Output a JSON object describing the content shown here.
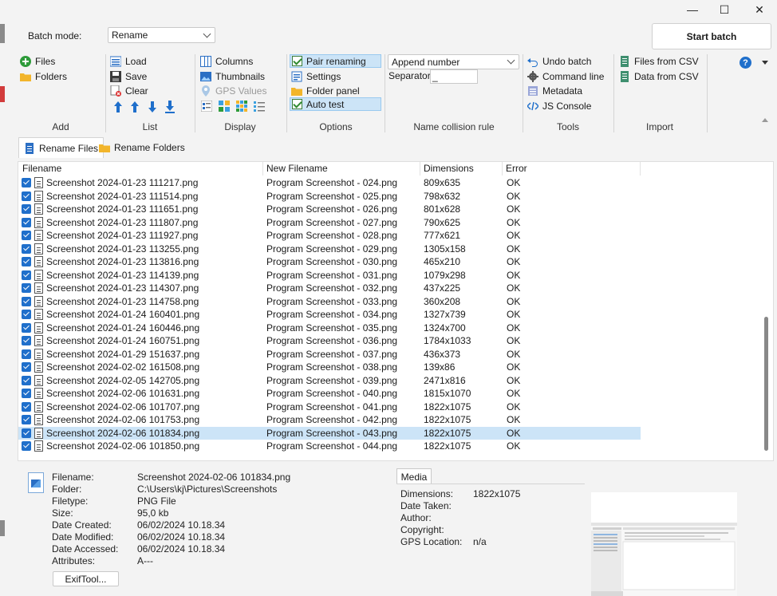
{
  "window": {
    "minimize_glyph": "—",
    "maximize_glyph": "☐",
    "close_glyph": "✕"
  },
  "topbar": {
    "batch_mode_label": "Batch mode:",
    "batch_mode_value": "Rename",
    "start_batch_label": "Start batch"
  },
  "ribbon": {
    "add": {
      "group_label": "Add",
      "files": "Files",
      "folders": "Folders"
    },
    "list": {
      "group_label": "List",
      "load": "Load",
      "save": "Save",
      "clear": "Clear"
    },
    "display": {
      "group_label": "Display",
      "columns": "Columns",
      "thumbnails": "Thumbnails",
      "gps_values": "GPS Values"
    },
    "options": {
      "group_label": "Options",
      "pair_renaming": "Pair renaming",
      "settings": "Settings",
      "folder_panel": "Folder panel",
      "auto_test": "Auto test"
    },
    "collision": {
      "group_label": "Name collision rule",
      "mode_value": "Append number",
      "separator_label": "Separator:",
      "separator_value": "_"
    },
    "tools": {
      "group_label": "Tools",
      "undo_batch": "Undo batch",
      "command_line": "Command line",
      "metadata": "Metadata",
      "js_console": "JS Console"
    },
    "import": {
      "group_label": "Import",
      "files_from_csv": "Files from CSV",
      "data_from_csv": "Data from CSV"
    },
    "help_glyph": "?"
  },
  "tabs": {
    "rename_files": "Rename Files",
    "rename_folders": "Rename Folders"
  },
  "table": {
    "headers": {
      "filename": "Filename",
      "new_filename": "New Filename",
      "dimensions": "Dimensions",
      "error": "Error"
    },
    "rows": [
      {
        "file": "Screenshot 2024-01-23 111217.png",
        "new": "Program Screenshot - 024.png",
        "dim": "809x635",
        "err": "OK"
      },
      {
        "file": "Screenshot 2024-01-23 111514.png",
        "new": "Program Screenshot - 025.png",
        "dim": "798x632",
        "err": "OK"
      },
      {
        "file": "Screenshot 2024-01-23 111651.png",
        "new": "Program Screenshot - 026.png",
        "dim": "801x628",
        "err": "OK"
      },
      {
        "file": "Screenshot 2024-01-23 111807.png",
        "new": "Program Screenshot - 027.png",
        "dim": "790x625",
        "err": "OK"
      },
      {
        "file": "Screenshot 2024-01-23 111927.png",
        "new": "Program Screenshot - 028.png",
        "dim": "777x621",
        "err": "OK"
      },
      {
        "file": "Screenshot 2024-01-23 113255.png",
        "new": "Program Screenshot - 029.png",
        "dim": "1305x158",
        "err": "OK"
      },
      {
        "file": "Screenshot 2024-01-23 113816.png",
        "new": "Program Screenshot - 030.png",
        "dim": "465x210",
        "err": "OK"
      },
      {
        "file": "Screenshot 2024-01-23 114139.png",
        "new": "Program Screenshot - 031.png",
        "dim": "1079x298",
        "err": "OK"
      },
      {
        "file": "Screenshot 2024-01-23 114307.png",
        "new": "Program Screenshot - 032.png",
        "dim": "437x225",
        "err": "OK"
      },
      {
        "file": "Screenshot 2024-01-23 114758.png",
        "new": "Program Screenshot - 033.png",
        "dim": "360x208",
        "err": "OK"
      },
      {
        "file": "Screenshot 2024-01-24 160401.png",
        "new": "Program Screenshot - 034.png",
        "dim": "1327x739",
        "err": "OK"
      },
      {
        "file": "Screenshot 2024-01-24 160446.png",
        "new": "Program Screenshot - 035.png",
        "dim": "1324x700",
        "err": "OK"
      },
      {
        "file": "Screenshot 2024-01-24 160751.png",
        "new": "Program Screenshot - 036.png",
        "dim": "1784x1033",
        "err": "OK"
      },
      {
        "file": "Screenshot 2024-01-29 151637.png",
        "new": "Program Screenshot - 037.png",
        "dim": "436x373",
        "err": "OK"
      },
      {
        "file": "Screenshot 2024-02-02 161508.png",
        "new": "Program Screenshot - 038.png",
        "dim": "139x86",
        "err": "OK"
      },
      {
        "file": "Screenshot 2024-02-05 142705.png",
        "new": "Program Screenshot - 039.png",
        "dim": "2471x816",
        "err": "OK"
      },
      {
        "file": "Screenshot 2024-02-06 101631.png",
        "new": "Program Screenshot - 040.png",
        "dim": "1815x1070",
        "err": "OK"
      },
      {
        "file": "Screenshot 2024-02-06 101707.png",
        "new": "Program Screenshot - 041.png",
        "dim": "1822x1075",
        "err": "OK"
      },
      {
        "file": "Screenshot 2024-02-06 101753.png",
        "new": "Program Screenshot - 042.png",
        "dim": "1822x1075",
        "err": "OK"
      },
      {
        "file": "Screenshot 2024-02-06 101834.png",
        "new": "Program Screenshot - 043.png",
        "dim": "1822x1075",
        "err": "OK",
        "selected": true
      },
      {
        "file": "Screenshot 2024-02-06 101850.png",
        "new": "Program Screenshot - 044.png",
        "dim": "1822x1075",
        "err": "OK"
      }
    ]
  },
  "details": {
    "filename_label": "Filename:",
    "filename": "Screenshot 2024-02-06 101834.png",
    "folder_label": "Folder:",
    "folder": "C:\\Users\\kj\\Pictures\\Screenshots",
    "filetype_label": "Filetype:",
    "filetype": "PNG File",
    "size_label": "Size:",
    "size": "95,0 kb",
    "created_label": "Date Created:",
    "created": "06/02/2024 10.18.34",
    "modified_label": "Date Modified:",
    "modified": "06/02/2024 10.18.34",
    "accessed_label": "Date Accessed:",
    "accessed": "06/02/2024 10.18.34",
    "attributes_label": "Attributes:",
    "attributes": "A---",
    "exiftool_label": "ExifTool..."
  },
  "media": {
    "tab_label": "Media",
    "dimensions_label": "Dimensions:",
    "dimensions": "1822x1075",
    "date_taken_label": "Date Taken:",
    "author_label": "Author:",
    "copyright_label": "Copyright:",
    "gps_label": "GPS Location:",
    "gps": "n/a"
  },
  "colors": {
    "accent": "#1f6fcb",
    "selection": "#cce4f7",
    "toggle_highlight": "#cce4f7"
  }
}
